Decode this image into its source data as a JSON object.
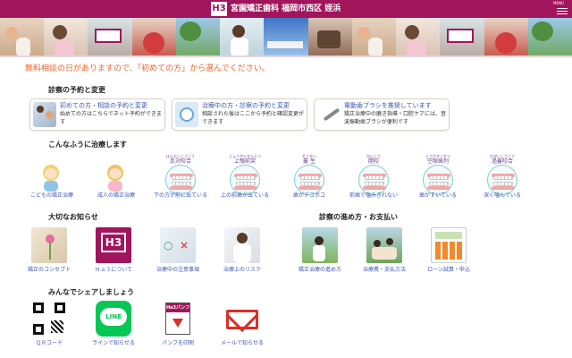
{
  "header": {
    "logo_text": "H3",
    "title": "宮園矯正歯科 福岡市西区 姪浜",
    "menu_label": "MENU"
  },
  "notice": "無料相談の日がありますので、「初めての方」から選んでください。",
  "reservation": {
    "heading": "診察の予約と変更",
    "cards": [
      {
        "title": "初めての方・相談の予約と変更",
        "desc": "始めての方はこちらでネット予約ができます"
      },
      {
        "title": "治療中の方・診察の予約と変更",
        "desc": "相談された後はここから予約と確認変更ができます"
      },
      {
        "title": "電動歯ブラシを推奨しています",
        "desc": "矯正治療中の磨き指導・口腔ケアには、音波振動歯ブラシが便利です"
      }
    ]
  },
  "treatments": {
    "heading": "こんなふうに治療します",
    "items": [
      {
        "ruby": "",
        "name": "",
        "caption": "こどもの矯正治療"
      },
      {
        "ruby": "",
        "name": "",
        "caption": "成人の矯正治療"
      },
      {
        "ruby": "はんたいこうごう",
        "name": "反対咬合",
        "caption": "下の方が前に出ている"
      },
      {
        "ruby": "じょうがくぜんとつ",
        "name": "上顎前突",
        "caption": "上の前歯が出ている"
      },
      {
        "ruby": "そうせい",
        "name": "叢 生",
        "caption": "歯がデコボコ"
      },
      {
        "ruby": "かいこう",
        "name": "開咬",
        "caption": "前歯で噛みきれない"
      },
      {
        "ruby": "くうげきしれつ",
        "name": "空隙歯列",
        "caption": "歯がすいている"
      },
      {
        "ruby": "かがいこうごう",
        "name": "過蓋咬合",
        "caption": "深く噛んでいる"
      }
    ]
  },
  "notices_section": {
    "heading": "大切なお知らせ",
    "logo_text": "H3",
    "items": [
      {
        "caption": "矯正のコンセプト"
      },
      {
        "caption": "Ｈａ３について"
      },
      {
        "caption": "治療中の注意事項"
      },
      {
        "caption": "治療上のリスク"
      }
    ]
  },
  "process": {
    "heading": "診察の進め方・お支払い",
    "items": [
      {
        "caption": "矯正治療の進め方"
      },
      {
        "caption": "治療費・支払方法"
      },
      {
        "caption": "ローン試算・申込"
      }
    ]
  },
  "share": {
    "heading": "みんなでシェアしましょう",
    "line_label": "LINE",
    "pamphlet_label": "Ha3パンフ",
    "items": [
      {
        "caption": "ＱＲコード"
      },
      {
        "caption": "ラインで知らせる"
      },
      {
        "caption": "パンフを印刷"
      },
      {
        "caption": "メールで知らせる"
      }
    ]
  },
  "colors": {
    "brand": "#a1155c",
    "notice": "#f0642b",
    "link": "#3b56b0",
    "line_green": "#06c755",
    "mail_red": "#d93025"
  }
}
